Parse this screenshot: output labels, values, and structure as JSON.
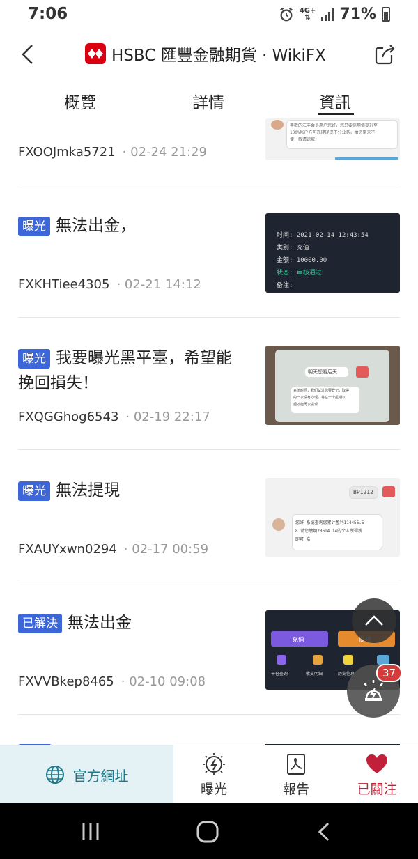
{
  "status": {
    "time": "7:06",
    "network": "4G+",
    "battery": "71%"
  },
  "header": {
    "title": "HSBC 匯豐金融期貨 · WikiFX"
  },
  "tabs": [
    {
      "label": "概覽"
    },
    {
      "label": "詳情"
    },
    {
      "label": "資訊",
      "active": true
    }
  ],
  "items": [
    {
      "badge": "",
      "title": "",
      "user": "FXOOJmka5721",
      "date": "· 02-24 21:29",
      "thumb_text": [
        "尊敬的汇丰会员用户您好，您只要信用值提升至",
        "100%帐户方可办理提现下分业务，给您带来不",
        "便，敬请谅解!"
      ]
    },
    {
      "badge": "曝光",
      "title": "無法出金，",
      "user": "FXKHTiee4305",
      "date": "· 02-21 14:12",
      "thumb_text": [
        "时间:  2021-02-14 12:43:54",
        "类别:  充值",
        "金额:  10000.00",
        "状态:  审核通过",
        "备注:"
      ]
    },
    {
      "badge": "曝光",
      "title": "我要曝光黑平臺，希望能挽回損失！",
      "user": "FXQGGhog6543",
      "date": "· 02-19 22:17",
      "thumb_text": [
        "明天您看后天",
        "充值时间，我们试过您要登记，取得",
        "的一次没有办理，将在一个星期以",
        "后才能再次提现"
      ]
    },
    {
      "badge": "曝光",
      "title": "無法提現",
      "user": "FXAUYxwn0294",
      "date": "· 02-17 00:59",
      "thumb_text": [
        "BP1212",
        "您好 系统查询您累计盈利114456.5",
        "8 请您缴纳28614.14的个人所得税",
        "即可 亲"
      ]
    },
    {
      "badge": "已解決",
      "title": "無法出金",
      "user": "FXVVBkep8465",
      "date": "· 02-10 09:08",
      "thumb_text": [
        "充值",
        "提现",
        "平仓查询",
        "收支明细",
        "历史信息"
      ]
    }
  ],
  "fab": {
    "count": "37"
  },
  "actions": {
    "official": "官方網址",
    "expose": "曝光",
    "report": "報告",
    "followed": "已關注"
  },
  "colors": {
    "badge": "#3d66d9",
    "accent": "#1f7a8c",
    "followed": "#c21f3a",
    "logo": "#db0011"
  }
}
